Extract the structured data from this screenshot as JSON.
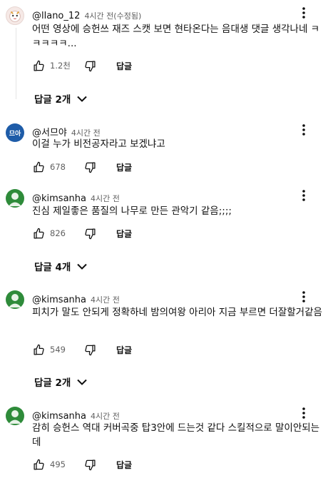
{
  "comments": [
    {
      "author": "@llano_12",
      "time": "4시간 전(수정됨)",
      "text": "어떤 영상에 승헌쓰 재즈 스캣 보면 현타온다는 음대생 댓글 생각나네 ㅋㅋㅋㅋㅋ...",
      "likes": "1.2천",
      "reply_label": "답글",
      "replies_toggle": "답글 2개"
    },
    {
      "author": "@서므야",
      "time": "4시간 전",
      "avatar_text": "므아",
      "text": "이걸 누가 비전공자라고 보겠냐고",
      "likes": "678",
      "reply_label": "답글"
    },
    {
      "author": "@kimsanha",
      "time": "4시간 전",
      "text": "진심 제일좋은 품질의 나무로 만든 관악기 같음;;;;",
      "likes": "826",
      "reply_label": "답글",
      "replies_toggle": "답글 4개"
    },
    {
      "author": "@kimsanha",
      "time": "4시간 전",
      "text": "피치가 말도 안되게 정확하네 밤의여왕 아리아 지금 부르면 더잘할거같음",
      "likes": "549",
      "reply_label": "답글",
      "replies_toggle": "답글 2개"
    },
    {
      "author": "@kimsanha",
      "time": "4시간 전",
      "text": "감히 승헌스 역대 커버곡중 탑3안에 드는것 같다 스킬적으로 말이안되는데",
      "likes": "495",
      "reply_label": "답글"
    }
  ],
  "icons": {
    "more": "more-vertical-icon",
    "like": "thumbs-up-icon",
    "dislike": "thumbs-down-icon",
    "chevron": "chevron-down-icon"
  }
}
